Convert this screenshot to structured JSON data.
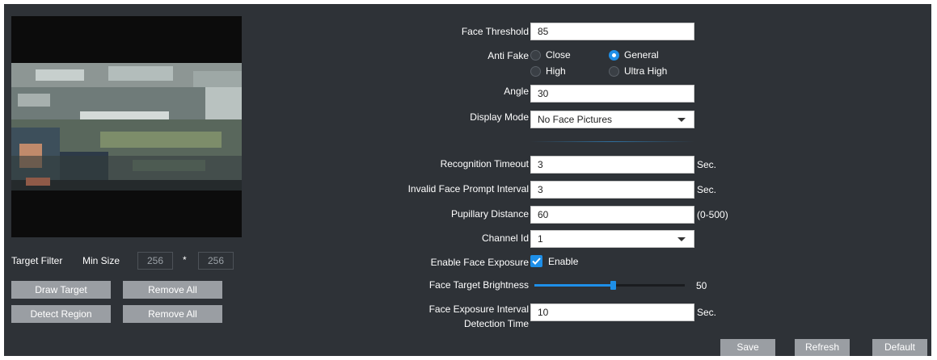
{
  "left": {
    "target_filter_label": "Target Filter",
    "min_size_label": "Min Size",
    "min_width": "256",
    "separator": "*",
    "min_height": "256",
    "draw_target_button": "Draw Target",
    "remove_all_button_1": "Remove All",
    "detect_region_button": "Detect Region",
    "remove_all_button_2": "Remove All"
  },
  "form": {
    "face_threshold": {
      "label": "Face Threshold",
      "value": "85"
    },
    "anti_fake": {
      "label": "Anti Fake",
      "options": [
        "Close",
        "General",
        "High",
        "Ultra High"
      ],
      "selected": "General"
    },
    "angle": {
      "label": "Angle",
      "value": "30"
    },
    "display_mode": {
      "label": "Display Mode",
      "value": "No Face Pictures"
    },
    "recognition_timeout": {
      "label": "Recognition Timeout",
      "value": "3",
      "unit": "Sec."
    },
    "invalid_face_prompt_interval": {
      "label": "Invalid Face Prompt Interval",
      "value": "3",
      "unit": "Sec."
    },
    "pupillary_distance": {
      "label": "Pupillary Distance",
      "value": "60",
      "unit": "(0-500)"
    },
    "channel_id": {
      "label": "Channel Id",
      "value": "1"
    },
    "enable_face_exposure": {
      "label": "Enable Face Exposure",
      "checkbox_label": "Enable",
      "checked": true
    },
    "face_target_brightness": {
      "label": "Face Target Brightness",
      "value": "50",
      "slider_fraction": 0.52
    },
    "face_exposure_interval": {
      "label_line1": "Face Exposure Interval",
      "label_line2": "Detection Time",
      "value": "10",
      "unit": "Sec."
    }
  },
  "actions": {
    "save": "Save",
    "refresh": "Refresh",
    "default": "Default"
  },
  "colors": {
    "panel_bg": "#2e3237",
    "accent": "#1e8fe8",
    "button_gray": "#9a9ea3"
  }
}
